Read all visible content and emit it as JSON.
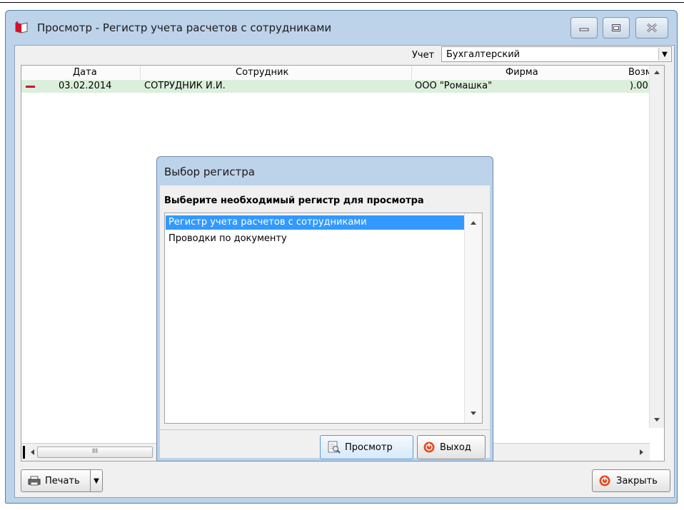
{
  "window": {
    "title": "Просмотр - Регистр учета расчетов с сотрудниками"
  },
  "filter": {
    "label": "Учет",
    "value": "Бухгалтерский"
  },
  "grid": {
    "columns": [
      "Дата",
      "Сотрудник",
      "Фирма",
      "Возм"
    ],
    "rows": [
      {
        "date": "03.02.2014",
        "employee": "СОТРУДНИК И.И.",
        "firm": "ООО \"Ромашка\"",
        "amount": ").00"
      }
    ],
    "hscroll_grip": "III"
  },
  "buttons": {
    "print": "Печать",
    "close": "Закрыть"
  },
  "dialog": {
    "title": "Выбор регистра",
    "prompt": "Выберите необходимый регистр для просмотра",
    "items": [
      "Регистр учета расчетов с сотрудниками",
      "Проводки по документу"
    ],
    "selected_index": 0,
    "view_button": "Просмотр",
    "exit_button": "Выход"
  },
  "colors": {
    "window_frame": "#bcd3ea",
    "selected_row": "#dcefdc",
    "selection": "#3399ff",
    "minus_marker": "#d0003a"
  }
}
